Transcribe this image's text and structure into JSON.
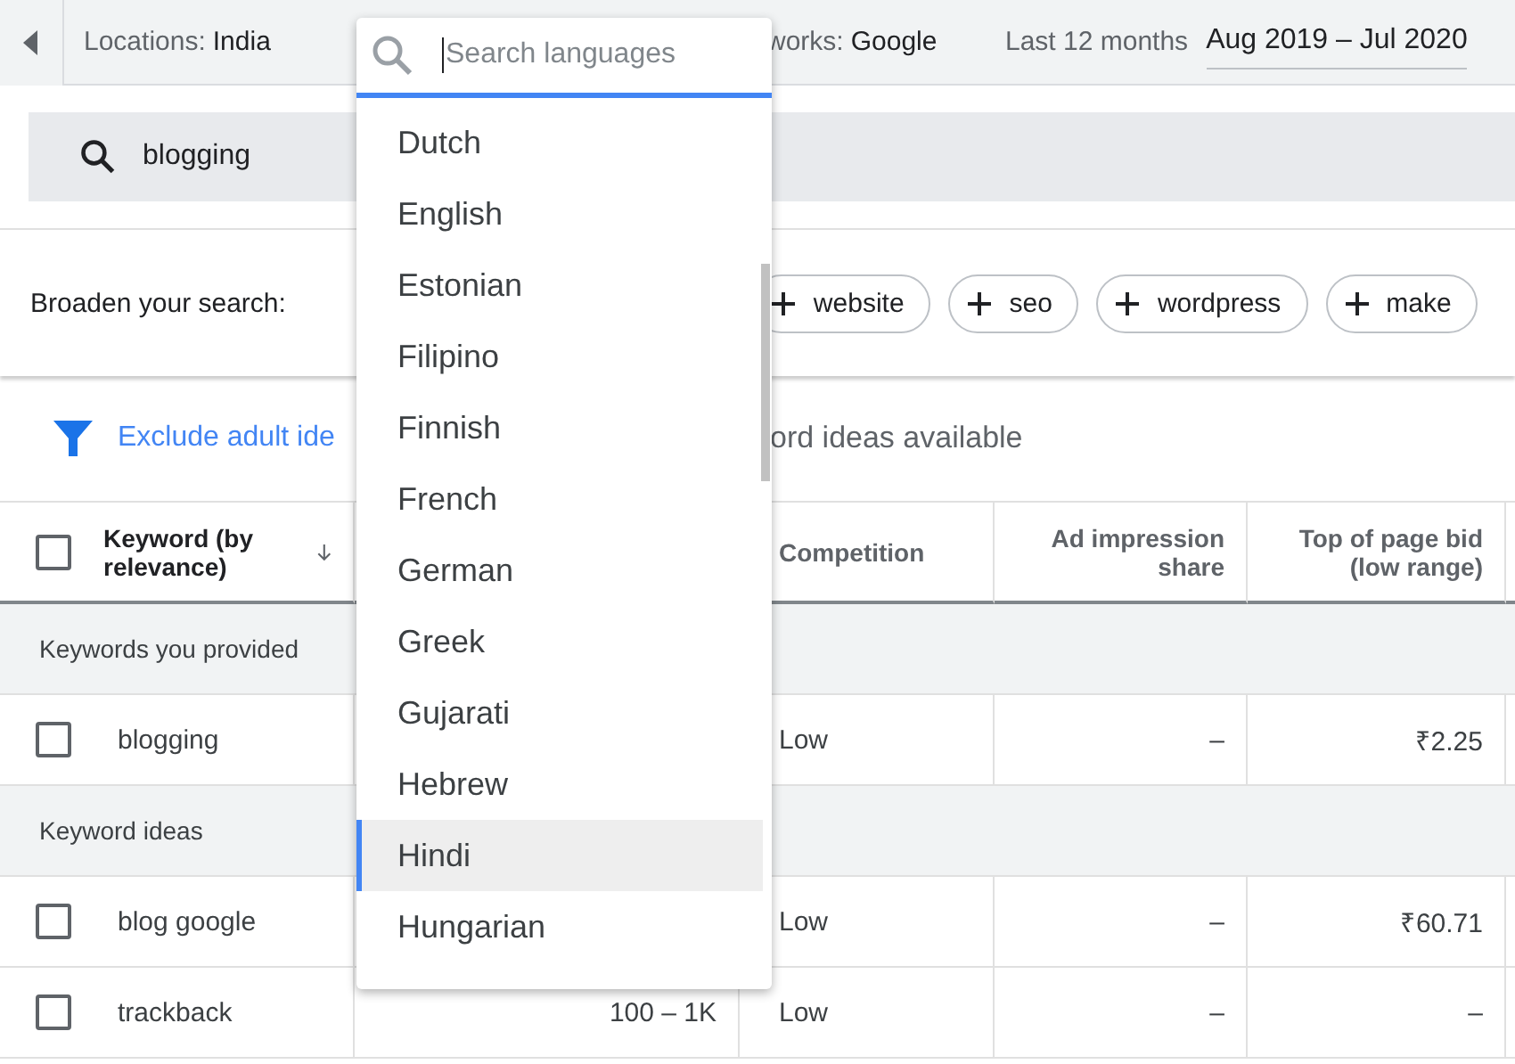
{
  "top_bar": {
    "locations_label": "Locations:",
    "locations_value": "India",
    "networks_label": "works:",
    "networks_value": "Google",
    "range_label": "Last 12 months",
    "range_value": "Aug 2019 – Jul 2020"
  },
  "search": {
    "value": "blogging"
  },
  "broaden": {
    "label": "Broaden your search:",
    "chips": [
      "website",
      "seo",
      "wordpress",
      "make"
    ]
  },
  "filter_bar": {
    "link": "Exclude adult ide",
    "summary": "ord ideas available"
  },
  "table": {
    "select_all_checked": false,
    "columns": [
      "Keyword (by relevance)",
      "",
      "Competition",
      "Ad impression share",
      "Top of page bid (low range)"
    ],
    "groups": [
      {
        "title": "Keywords you provided",
        "rows": [
          {
            "keyword": "blogging",
            "searches": "",
            "competition": "Low",
            "share": "–",
            "bid": "₹2.25",
            "checked": false
          }
        ]
      },
      {
        "title": "Keyword ideas",
        "rows": [
          {
            "keyword": "blog google",
            "searches": "",
            "competition": "Low",
            "share": "–",
            "bid": "₹60.71",
            "checked": false
          },
          {
            "keyword": "trackback",
            "searches": "100 – 1K",
            "competition": "Low",
            "share": "–",
            "bid": "–",
            "checked": false
          }
        ]
      }
    ]
  },
  "language_dropdown": {
    "placeholder": "Search languages",
    "options": [
      {
        "label": "Dutch",
        "selected": false
      },
      {
        "label": "English",
        "selected": false
      },
      {
        "label": "Estonian",
        "selected": false
      },
      {
        "label": "Filipino",
        "selected": false
      },
      {
        "label": "Finnish",
        "selected": false
      },
      {
        "label": "French",
        "selected": false
      },
      {
        "label": "German",
        "selected": false
      },
      {
        "label": "Greek",
        "selected": false
      },
      {
        "label": "Gujarati",
        "selected": false
      },
      {
        "label": "Hebrew",
        "selected": false
      },
      {
        "label": "Hindi",
        "selected": true
      },
      {
        "label": "Hungarian",
        "selected": false
      }
    ]
  }
}
